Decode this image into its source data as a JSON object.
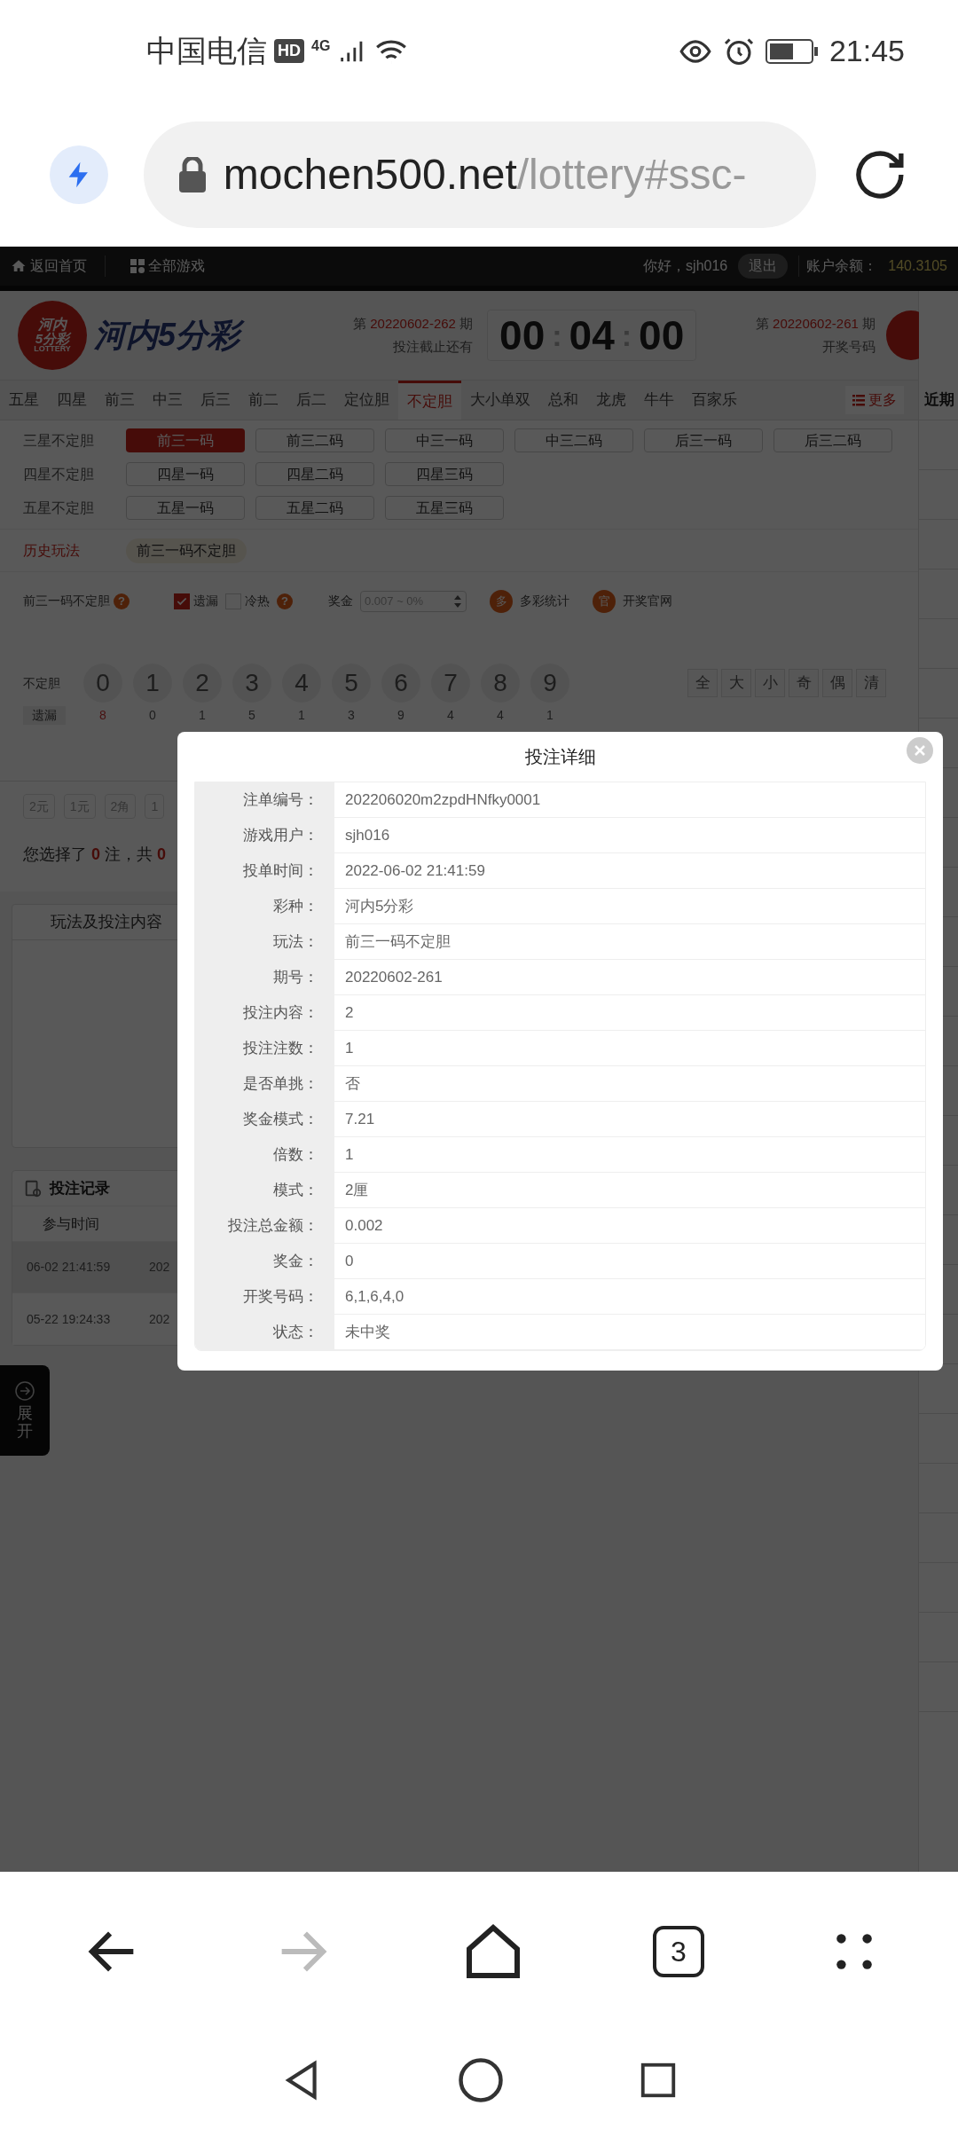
{
  "status_bar": {
    "carrier": "中国电信",
    "hd_badge": "HD",
    "network": "4G",
    "time": "21:45"
  },
  "browser": {
    "url_host": "mochen500.net",
    "url_path": "/lottery#ssc-"
  },
  "top_nav": {
    "home": "返回首页",
    "games": "全部游戏",
    "greeting": "你好，sjh016",
    "logout": "退出",
    "balance_label": "账户余额：",
    "balance": "140.3105"
  },
  "header": {
    "logo_badge": [
      "河内",
      "5分彩",
      "LOTTERY"
    ],
    "logo_text": "河内5分彩",
    "current_issue": {
      "prefix": "第",
      "number": "20220602-262",
      "suffix": "期",
      "caption": "投注截止还有"
    },
    "countdown": [
      "00",
      ":",
      "04",
      ":",
      "00"
    ],
    "last_issue": {
      "prefix": "第",
      "number": "20220602-261",
      "suffix": "期",
      "caption": "开奖号码"
    }
  },
  "tabs": [
    {
      "label": "五星",
      "selected": false
    },
    {
      "label": "四星",
      "selected": false
    },
    {
      "label": "前三",
      "selected": false
    },
    {
      "label": "中三",
      "selected": false
    },
    {
      "label": "后三",
      "selected": false
    },
    {
      "label": "前二",
      "selected": false
    },
    {
      "label": "后二",
      "selected": false
    },
    {
      "label": "定位胆",
      "selected": false
    },
    {
      "label": "不定胆",
      "selected": true
    },
    {
      "label": "大小单双",
      "selected": false
    },
    {
      "label": "总和",
      "selected": false
    },
    {
      "label": "龙虎",
      "selected": false
    },
    {
      "label": "牛牛",
      "selected": false
    },
    {
      "label": "百家乐",
      "selected": false
    }
  ],
  "more_button": "更多",
  "recent_heading": "近期",
  "play_groups": [
    {
      "label": "三星不定胆",
      "options": [
        {
          "label": "前三一码",
          "selected": true
        },
        {
          "label": "前三二码",
          "selected": false
        },
        {
          "label": "中三一码",
          "selected": false
        },
        {
          "label": "中三二码",
          "selected": false
        },
        {
          "label": "后三一码",
          "selected": false
        },
        {
          "label": "后三二码",
          "selected": false
        }
      ]
    },
    {
      "label": "四星不定胆",
      "options": [
        {
          "label": "四星一码",
          "selected": false
        },
        {
          "label": "四星二码",
          "selected": false
        },
        {
          "label": "四星三码",
          "selected": false
        }
      ]
    },
    {
      "label": "五星不定胆",
      "options": [
        {
          "label": "五星一码",
          "selected": false
        },
        {
          "label": "五星二码",
          "selected": false
        },
        {
          "label": "五星三码",
          "selected": false
        }
      ]
    }
  ],
  "history": {
    "label": "历史玩法",
    "items": [
      "前三一码不定胆"
    ]
  },
  "options": {
    "play_name": "前三一码不定胆",
    "help_marks": [
      "?",
      "?"
    ],
    "checkboxes": [
      {
        "label": "遗漏",
        "checked": true
      },
      {
        "label": "冷热",
        "checked": false
      }
    ],
    "prize_label": "奖金",
    "prize_placeholder": "0.007 ~ 0%",
    "links": [
      {
        "badge": "多",
        "label": "多彩统计"
      },
      {
        "badge": "官",
        "label": "开奖官网"
      }
    ]
  },
  "number_picker": {
    "label": "不定胆",
    "numbers": [
      "0",
      "1",
      "2",
      "3",
      "4",
      "5",
      "6",
      "7",
      "8",
      "9"
    ],
    "omission_label": "遗漏",
    "omissions": [
      "8",
      "0",
      "1",
      "5",
      "1",
      "3",
      "9",
      "4",
      "4",
      "1"
    ],
    "quick": [
      "全",
      "大",
      "小",
      "奇",
      "偶",
      "清"
    ]
  },
  "units": [
    "2元",
    "1元",
    "2角",
    "1"
  ],
  "selection_summary": {
    "prefix": "您选择了",
    "count": "0",
    "middle": "注，共",
    "total": "0"
  },
  "bet_panel": {
    "title": "玩法及投注内容"
  },
  "records": {
    "title": "投注记录",
    "columns": [
      "参与时间"
    ],
    "rows": [
      {
        "time": "06-02 21:41:59",
        "issue": "202",
        "selected": true
      },
      {
        "time": "05-22 19:24:33",
        "issue": "202",
        "selected": false
      }
    ]
  },
  "expand_button": "展开",
  "modal": {
    "title": "投注详细",
    "rows": [
      {
        "label": "注单编号：",
        "value": "202206020m2zpdHNfky0001"
      },
      {
        "label": "游戏用户：",
        "value": "sjh016"
      },
      {
        "label": "投单时间：",
        "value": "2022-06-02 21:41:59"
      },
      {
        "label": "彩种：",
        "value": "河内5分彩"
      },
      {
        "label": "玩法：",
        "value": "前三一码不定胆"
      },
      {
        "label": "期号：",
        "value": "20220602-261"
      },
      {
        "label": "投注内容：",
        "value": "2"
      },
      {
        "label": "投注注数：",
        "value": "1"
      },
      {
        "label": "是否单挑：",
        "value": "否"
      },
      {
        "label": "奖金模式：",
        "value": "7.21"
      },
      {
        "label": "倍数：",
        "value": "1"
      },
      {
        "label": "模式：",
        "value": "2厘"
      },
      {
        "label": "投注总金额：",
        "value": "0.002"
      },
      {
        "label": "奖金：",
        "value": "0"
      },
      {
        "label": "开奖号码：",
        "value": "6,1,6,4,0"
      },
      {
        "label": "状态：",
        "value": "未中奖"
      }
    ]
  },
  "bottom_bar": {
    "tab_count": "3",
    "forward_disabled": true
  }
}
